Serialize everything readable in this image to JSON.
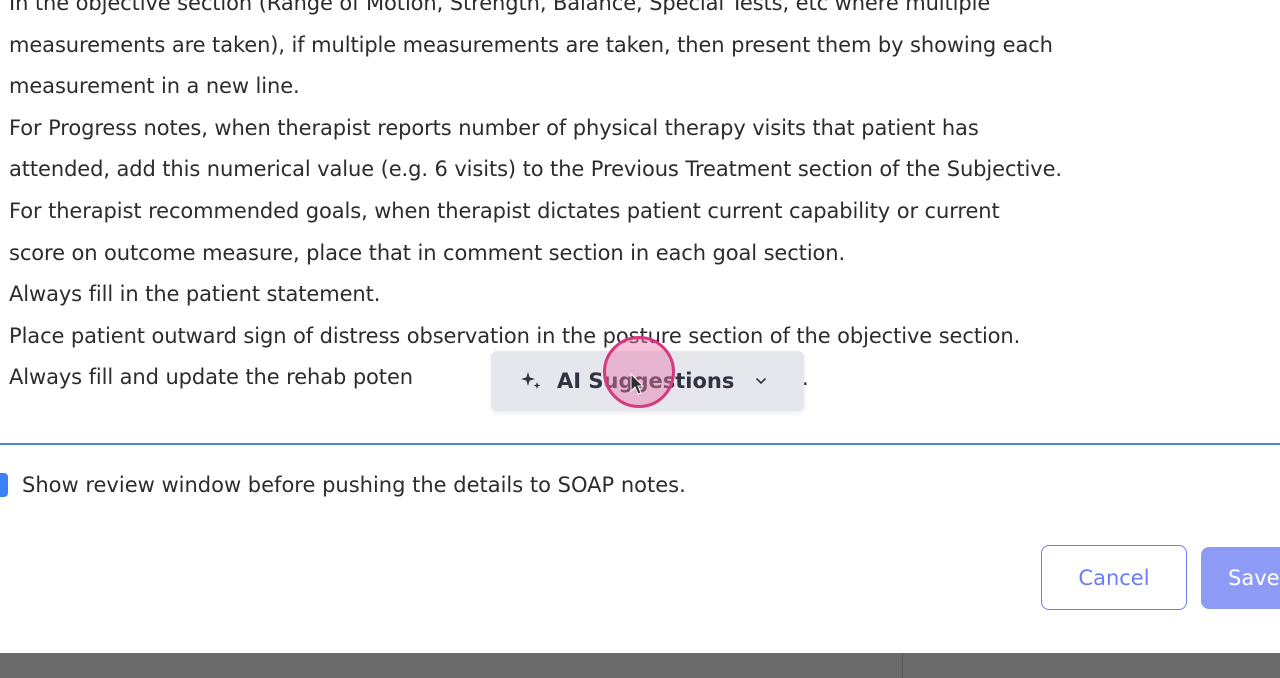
{
  "instructions": {
    "lines": [
      "In the objective section (Range of Motion, Strength, Balance, Special Tests, etc where multiple",
      "measurements are taken), if multiple measurements are taken, then present them by showing each",
      "measurement in a new line.",
      "For Progress notes, when therapist reports number of physical therapy visits that patient has",
      "attended, add this numerical value (e.g. 6 visits) to the Previous Treatment section of the Subjective.",
      "For therapist recommended goals, when therapist dictates patient current capability or current",
      "score on outcome measure, place that in comment section in each goal section.",
      "Always fill in the patient statement.",
      "Place patient outward sign of distress observation in the posture section of the objective section.",
      "Always fill and update the rehab poten"
    ],
    "trailing_char": "."
  },
  "ai_popup": {
    "label": "AI Suggestions",
    "icon": "sparkle-icon",
    "chevron": "chevron-down-icon"
  },
  "review": {
    "checked": true,
    "label": "Show review window before pushing the details to SOAP notes."
  },
  "buttons": {
    "cancel_label": "Cancel",
    "save_label": "Save"
  },
  "colors": {
    "accent": "#6b7cf6",
    "save_bg": "#8d9bf7",
    "divider": "#4a86e0",
    "checkbox": "#3b82f6",
    "cursor_ring": "#d6387e"
  }
}
